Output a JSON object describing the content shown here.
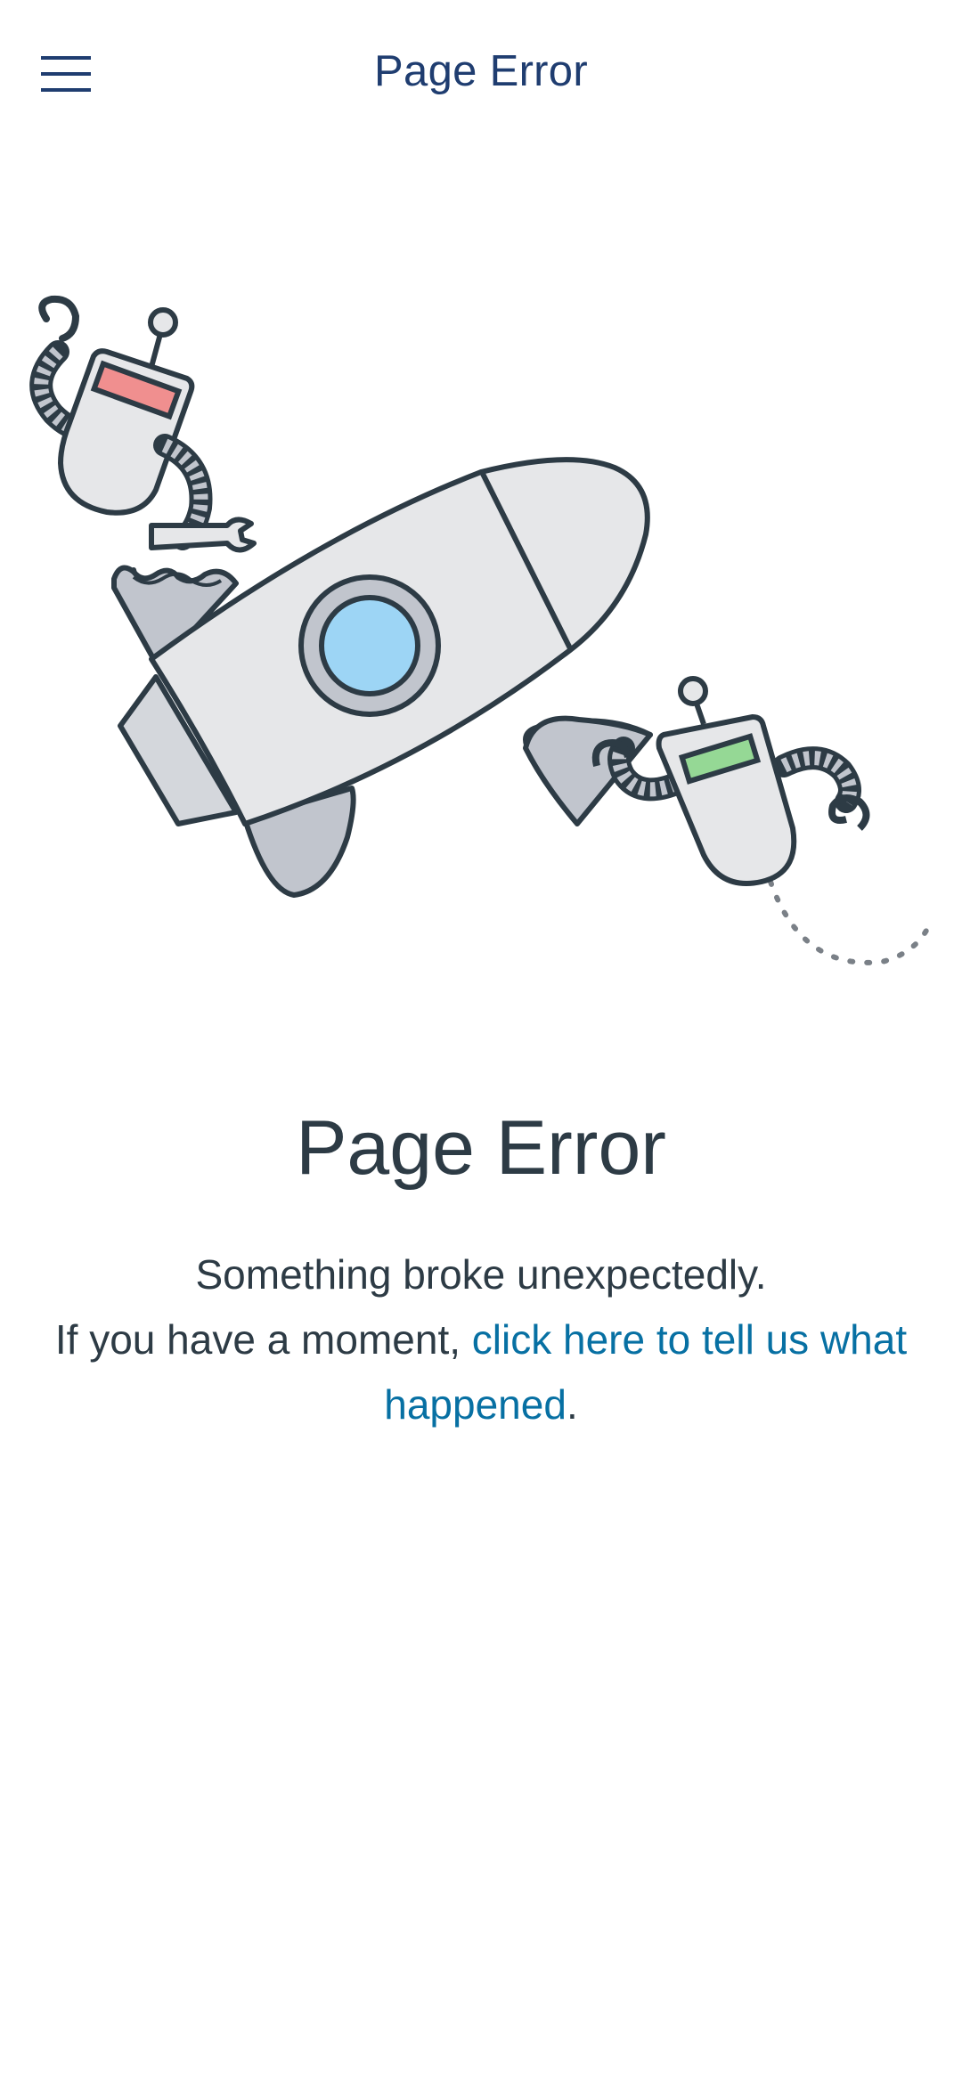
{
  "header": {
    "menu_icon": "hamburger-menu-icon",
    "title": "Page Error"
  },
  "illustration": {
    "subject": "rocket-with-two-robots-icon",
    "colors": {
      "outline": "#2d3b45",
      "hull": "#e6e7e9",
      "fins": "#c1c5cd",
      "porthole": "#9dd5f5",
      "robot_left_visor": "#f08f8f",
      "robot_right_visor": "#95d895"
    }
  },
  "main": {
    "heading": "Page Error",
    "message_line1": "Something broke unexpectedly.",
    "message_prefix": "If you have a moment, ",
    "link_text": "click here to tell us what happened",
    "message_suffix": "."
  },
  "colors": {
    "header_title": "#1f3d70",
    "text": "#2d3b45",
    "link": "#0770a3",
    "background": "#ffffff"
  }
}
